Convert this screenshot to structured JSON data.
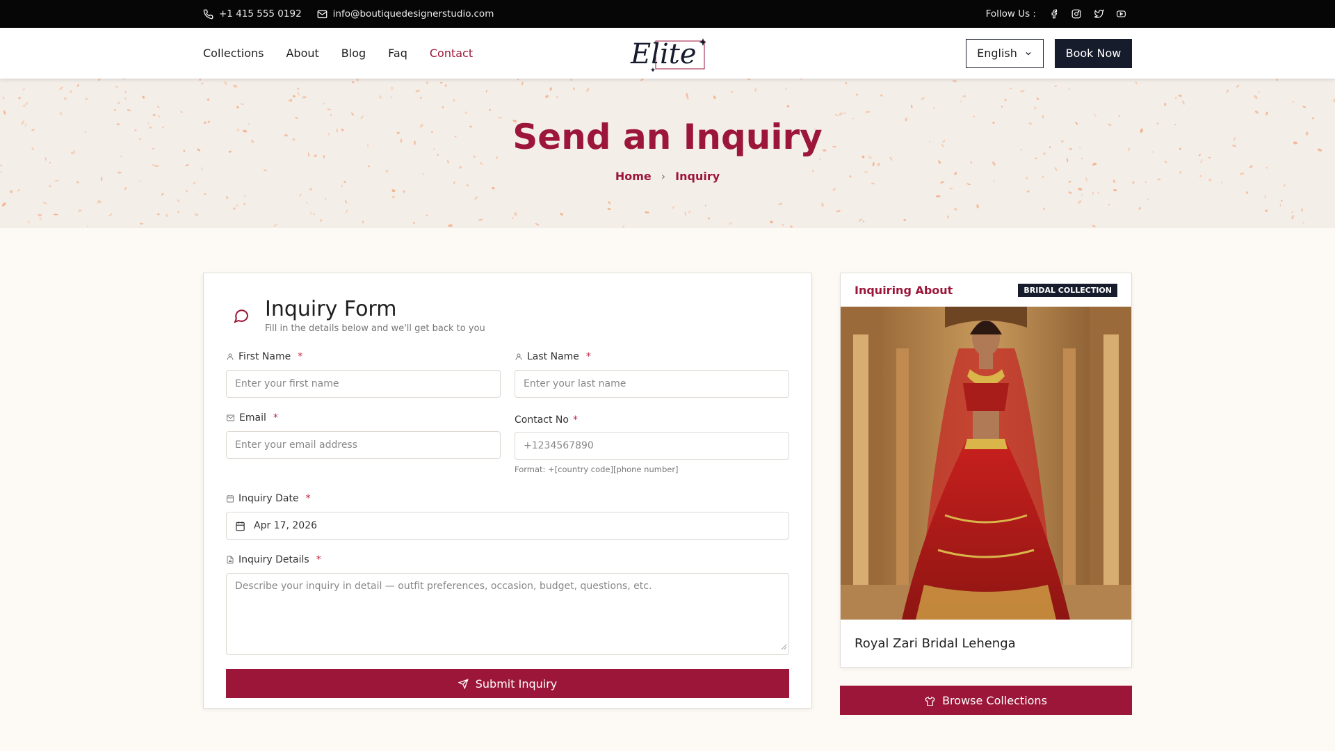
{
  "topbar": {
    "phone": "+1 415 555 0192",
    "email": "info@boutiquedesignerstudio.com",
    "follow_label": "Follow Us :",
    "social_icons": [
      "facebook-icon",
      "instagram-icon",
      "twitter-icon",
      "youtube-icon"
    ]
  },
  "nav": {
    "links": [
      "Collections",
      "About",
      "Blog",
      "Faq",
      "Contact"
    ],
    "active": "Contact",
    "logo_text": "Elite",
    "language": "English",
    "book_label": "Book Now"
  },
  "hero": {
    "title": "Send an Inquiry",
    "breadcrumb": [
      "Home",
      "Inquiry"
    ]
  },
  "form": {
    "title": "Inquiry Form",
    "subtitle": "Fill in the details below and we'll get back to you",
    "required_mark": "*",
    "first_name": {
      "label": "First Name",
      "placeholder": "Enter your first name"
    },
    "last_name": {
      "label": "Last Name",
      "placeholder": "Enter your last name"
    },
    "email": {
      "label": "Email",
      "placeholder": "Enter your email address"
    },
    "contact": {
      "label": "Contact No",
      "placeholder": "+1234567890",
      "hint": "Format: +[country code][phone number]"
    },
    "date": {
      "label": "Inquiry Date",
      "value": "Apr 17, 2026"
    },
    "details": {
      "label": "Inquiry Details",
      "placeholder": "Describe your inquiry in detail — outfit preferences, occasion, budget, questions, etc."
    },
    "submit_label": "Submit Inquiry"
  },
  "sidebar": {
    "title": "Inquiring About",
    "badge": "BRIDAL COLLECTION",
    "product_name": "Royal Zari Bridal Lehenga",
    "browse_label": "Browse Collections"
  },
  "colors": {
    "brand": "#9b1638",
    "navy": "#161c2c",
    "topbar": "#060606",
    "hero_bg": "#f4eee9",
    "page_bg": "#fdf9f4"
  }
}
